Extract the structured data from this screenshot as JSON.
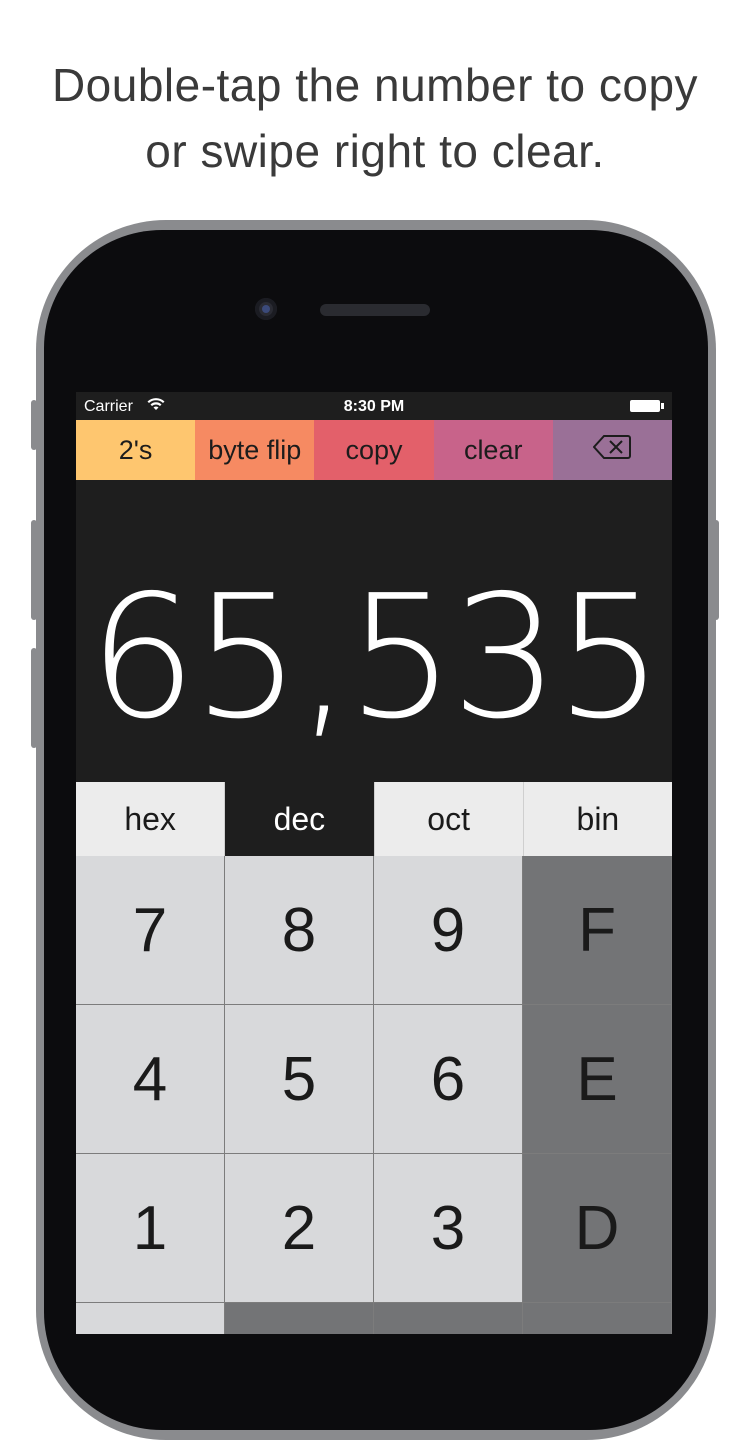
{
  "caption": {
    "line1": "Double-tap the number to copy",
    "line2": "or swipe right to clear."
  },
  "statusbar": {
    "carrier": "Carrier",
    "time": "8:30 PM"
  },
  "actions": [
    {
      "label": "2's",
      "color": "#fec66f"
    },
    {
      "label": "byte flip",
      "color": "#f68a62"
    },
    {
      "label": "copy",
      "color": "#e3606a"
    },
    {
      "label": "clear",
      "color": "#c8638a"
    },
    {
      "label": "",
      "icon": "backspace-icon",
      "color": "#9a7097"
    }
  ],
  "display": {
    "value": "65,535"
  },
  "modes": [
    {
      "label": "hex",
      "active": false
    },
    {
      "label": "dec",
      "active": true
    },
    {
      "label": "oct",
      "active": false
    },
    {
      "label": "bin",
      "active": false
    }
  ],
  "keys": [
    {
      "label": "7",
      "type": "digit"
    },
    {
      "label": "8",
      "type": "digit"
    },
    {
      "label": "9",
      "type": "digit"
    },
    {
      "label": "F",
      "type": "hex"
    },
    {
      "label": "4",
      "type": "digit"
    },
    {
      "label": "5",
      "type": "digit"
    },
    {
      "label": "6",
      "type": "digit"
    },
    {
      "label": "E",
      "type": "hex"
    },
    {
      "label": "1",
      "type": "digit"
    },
    {
      "label": "2",
      "type": "digit"
    },
    {
      "label": "3",
      "type": "digit"
    },
    {
      "label": "D",
      "type": "hex"
    },
    {
      "label": "",
      "type": "digit"
    },
    {
      "label": "",
      "type": "hex"
    },
    {
      "label": "",
      "type": "hex"
    },
    {
      "label": "",
      "type": "hex"
    }
  ]
}
